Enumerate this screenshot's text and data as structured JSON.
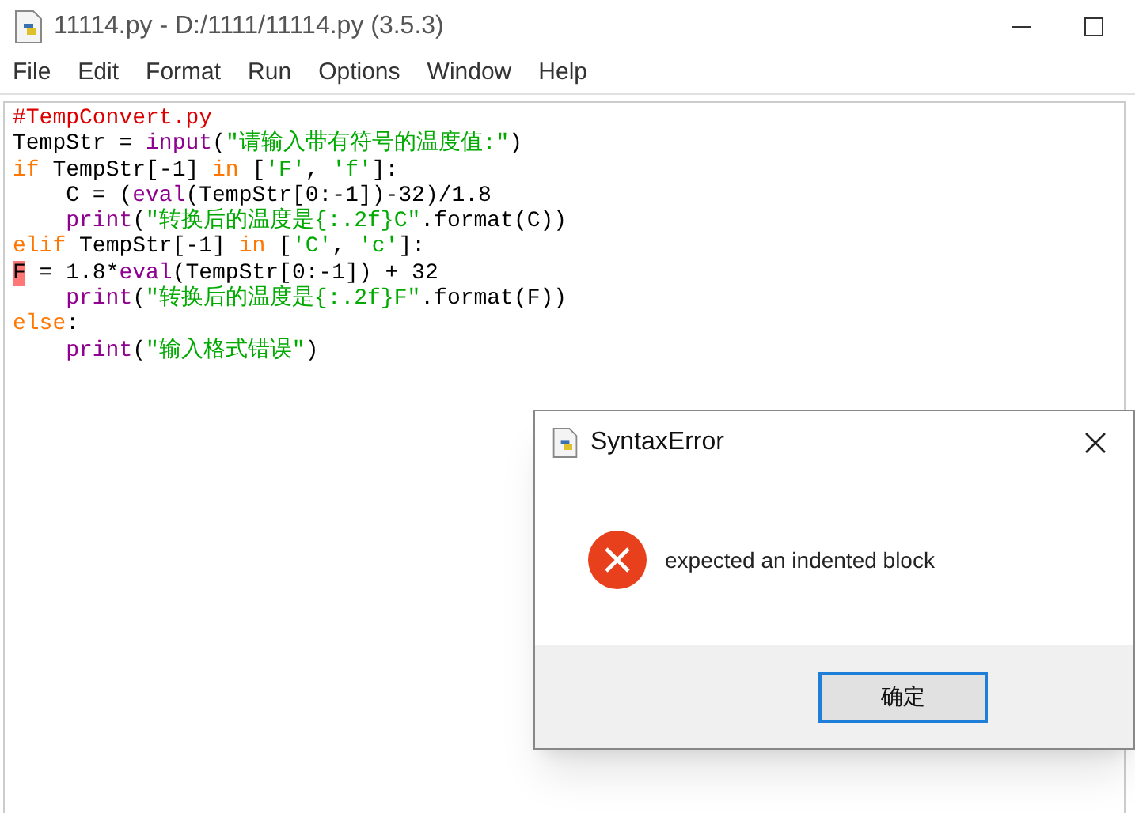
{
  "window": {
    "title": "11114.py - D:/1111/11114.py (3.5.3)"
  },
  "menu": [
    "File",
    "Edit",
    "Format",
    "Run",
    "Options",
    "Window",
    "Help"
  ],
  "code_lines": [
    {
      "indented": false,
      "tokens": [
        {
          "kind": "comment",
          "text": "#TempConvert.py"
        }
      ]
    },
    {
      "indented": false,
      "tokens": [
        {
          "kind": "plain",
          "text": "TempStr = "
        },
        {
          "kind": "builtin",
          "text": "input"
        },
        {
          "kind": "plain",
          "text": "("
        },
        {
          "kind": "string",
          "text": "\"请输入带有符号的温度值:\""
        },
        {
          "kind": "plain",
          "text": ")"
        }
      ]
    },
    {
      "indented": false,
      "tokens": [
        {
          "kind": "keyword",
          "text": "if"
        },
        {
          "kind": "plain",
          "text": " TempStr[-1] "
        },
        {
          "kind": "keyword",
          "text": "in"
        },
        {
          "kind": "plain",
          "text": " ["
        },
        {
          "kind": "string",
          "text": "'F'"
        },
        {
          "kind": "plain",
          "text": ", "
        },
        {
          "kind": "string",
          "text": "'f'"
        },
        {
          "kind": "plain",
          "text": "]:"
        }
      ]
    },
    {
      "indented": true,
      "tokens": [
        {
          "kind": "plain",
          "text": "C = ("
        },
        {
          "kind": "builtin",
          "text": "eval"
        },
        {
          "kind": "plain",
          "text": "(TempStr[0:-1])-32)/1.8"
        }
      ]
    },
    {
      "indented": true,
      "tokens": [
        {
          "kind": "builtin",
          "text": "print"
        },
        {
          "kind": "plain",
          "text": "("
        },
        {
          "kind": "string",
          "text": "\"转换后的温度是{:.2f}C\""
        },
        {
          "kind": "plain",
          "text": ".format(C))"
        }
      ]
    },
    {
      "indented": false,
      "tokens": [
        {
          "kind": "keyword",
          "text": "elif"
        },
        {
          "kind": "plain",
          "text": " TempStr[-1] "
        },
        {
          "kind": "keyword",
          "text": "in"
        },
        {
          "kind": "plain",
          "text": " ["
        },
        {
          "kind": "string",
          "text": "'C'"
        },
        {
          "kind": "plain",
          "text": ", "
        },
        {
          "kind": "string",
          "text": "'c'"
        },
        {
          "kind": "plain",
          "text": "]:"
        }
      ]
    },
    {
      "indented": false,
      "tokens": [
        {
          "kind": "error",
          "text": "F"
        },
        {
          "kind": "plain",
          "text": " = 1.8*"
        },
        {
          "kind": "builtin",
          "text": "eval"
        },
        {
          "kind": "plain",
          "text": "(TempStr[0:-1]) + 32"
        }
      ]
    },
    {
      "indented": true,
      "tokens": [
        {
          "kind": "builtin",
          "text": "print"
        },
        {
          "kind": "plain",
          "text": "("
        },
        {
          "kind": "string",
          "text": "\"转换后的温度是{:.2f}F\""
        },
        {
          "kind": "plain",
          "text": ".format(F))"
        }
      ]
    },
    {
      "indented": false,
      "tokens": [
        {
          "kind": "keyword",
          "text": "else"
        },
        {
          "kind": "plain",
          "text": ":"
        }
      ]
    },
    {
      "indented": true,
      "tokens": [
        {
          "kind": "builtin",
          "text": "print"
        },
        {
          "kind": "plain",
          "text": "("
        },
        {
          "kind": "string",
          "text": "\"输入格式错误\""
        },
        {
          "kind": "plain",
          "text": ")"
        }
      ]
    }
  ],
  "dialog": {
    "title": "SyntaxError",
    "message": "expected an indented block",
    "button": "确定"
  }
}
